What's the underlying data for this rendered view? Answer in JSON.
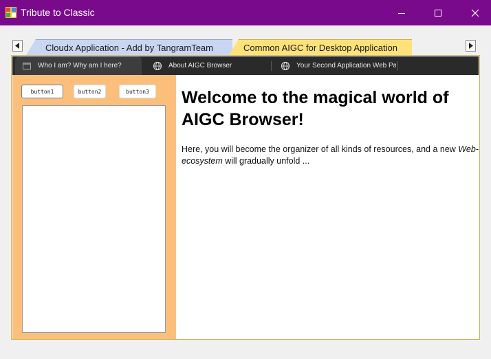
{
  "window": {
    "title": "Tribute to Classic",
    "titlebar_color": "#7a0a8c",
    "controls": [
      "minimize-icon",
      "maximize-icon",
      "close-icon"
    ]
  },
  "outer_tabs": [
    {
      "label": "Cloudx Application - Add by TangramTeam",
      "color": "#c9d6f2",
      "active": false
    },
    {
      "label": "Common AIGC for Desktop Application",
      "color": "#fde27a",
      "active": true
    }
  ],
  "browser_tabs": [
    {
      "label": "Who I am? Why am I here?",
      "icon": "page-icon",
      "active": true
    },
    {
      "label": "About AIGC Browser",
      "icon": "globe-icon",
      "active": false
    },
    {
      "label": "Your Second Application Web Pa",
      "icon": "globe-icon",
      "active": false
    }
  ],
  "left_panel": {
    "background": "#fbbf7b",
    "buttons": [
      "button1",
      "button2",
      "button3"
    ]
  },
  "web": {
    "heading": "Welcome to the magical world of AIGC Browser!",
    "para_before": "Here, you will become the organizer of all kinds of resources, and a new ",
    "para_em": "Web-ecosystem",
    "para_after": " will gradually unfold ..."
  }
}
